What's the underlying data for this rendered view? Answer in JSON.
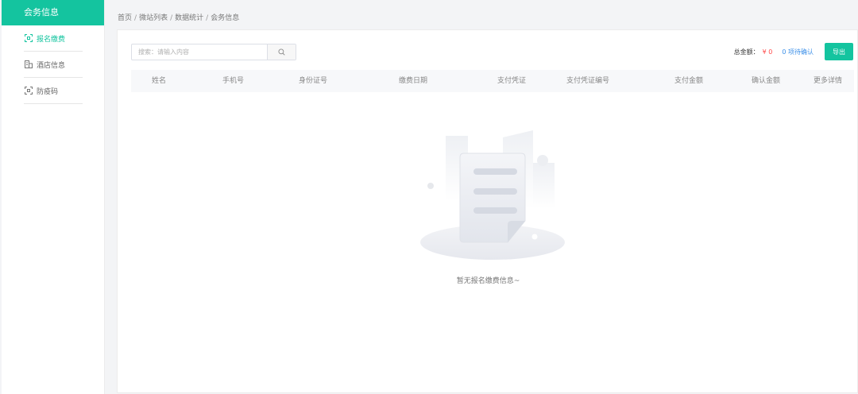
{
  "sidebar": {
    "header": "会务信息",
    "items": [
      {
        "label": "报名缴费",
        "icon": "qr-scan-icon",
        "active": true
      },
      {
        "label": "酒店信息",
        "icon": "building-icon",
        "active": false
      },
      {
        "label": "防疫码",
        "icon": "qr-code-icon",
        "active": false
      }
    ]
  },
  "breadcrumb": {
    "items": [
      "首页",
      "微站列表",
      "数据统计",
      "会务信息"
    ],
    "separator": "/"
  },
  "toolbar": {
    "search_placeholder": "搜索：请输入内容",
    "total_label": "总金额：",
    "total_amount": "¥ 0",
    "pending_text": "0 项待确认",
    "export_label": "导出"
  },
  "table": {
    "columns": [
      "姓名",
      "手机号",
      "身份证号",
      "缴费日期",
      "支付凭证",
      "支付凭证编号",
      "支付金额",
      "确认金额",
      "更多详情"
    ]
  },
  "empty_state": {
    "text": "暂无报名缴费信息~"
  },
  "colors": {
    "accent": "#14c49f",
    "amount": "#ff4a4a",
    "link": "#3b8fe8"
  }
}
